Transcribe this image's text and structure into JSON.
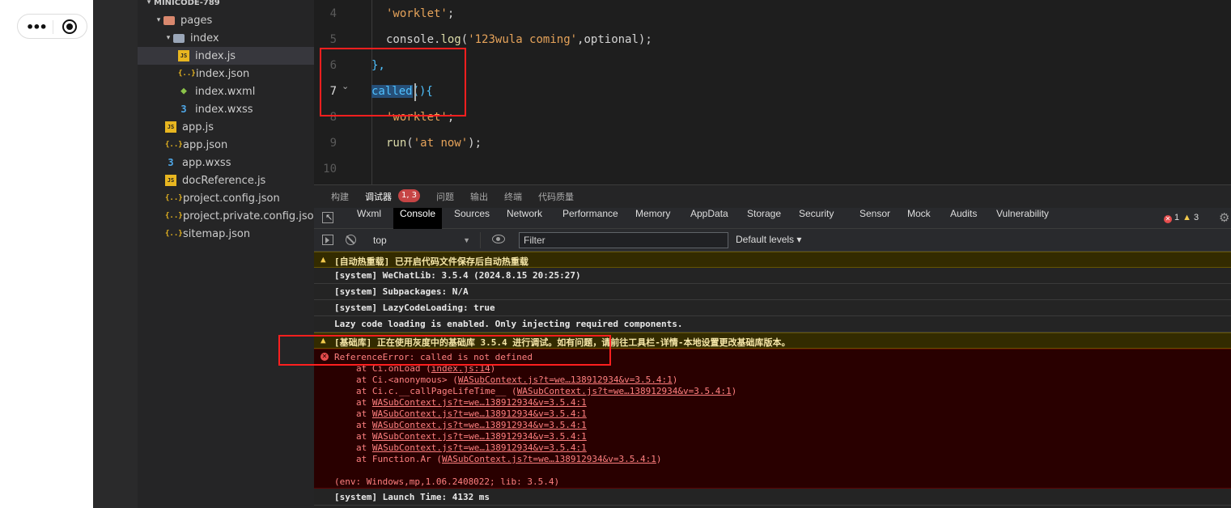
{
  "simulator": {
    "capsule_more": "•••"
  },
  "explorer": {
    "project": "MINICODE-789",
    "items": [
      {
        "label": "pages",
        "type": "folder"
      },
      {
        "label": "index",
        "type": "folder-open"
      },
      {
        "label": "index.js",
        "type": "js"
      },
      {
        "label": "index.json",
        "type": "json"
      },
      {
        "label": "index.wxml",
        "type": "wxml"
      },
      {
        "label": "index.wxss",
        "type": "wxss"
      },
      {
        "label": "app.js",
        "type": "js"
      },
      {
        "label": "app.json",
        "type": "json"
      },
      {
        "label": "app.wxss",
        "type": "wxss"
      },
      {
        "label": "docReference.js",
        "type": "js"
      },
      {
        "label": "project.config.json",
        "type": "json"
      },
      {
        "label": "project.private.config.json",
        "type": "json"
      },
      {
        "label": "sitemap.json",
        "type": "json"
      }
    ],
    "active_item": "index.js",
    "icon_glyphs": {
      "js": "JS",
      "json": "{..}",
      "wxml": "◆",
      "wxss": "З",
      "folder": "",
      "folder-open": ""
    }
  },
  "editor": {
    "line_numbers": [
      "4",
      "5",
      "6",
      "7",
      "8",
      "9",
      "10"
    ],
    "current_line": "7",
    "lines": {
      "l4_str": "'worklet'",
      "l4_p": ";",
      "l5_obj": "console",
      "l5_dot": ".",
      "l5_fn": "log",
      "l5_open": "(",
      "l5_str": "'123wula coming'",
      "l5_rest": ",optional);",
      "l6": "},",
      "l7_sel": "called",
      "l7_rest": "(){",
      "l8_str": "'worklet'",
      "l8_p": ";",
      "l9_fn": "run",
      "l9_open": "(",
      "l9_str": "'at now'",
      "l9_rest": ");"
    }
  },
  "panel_tabs": {
    "items": [
      "构建",
      "调试器",
      "问题",
      "输出",
      "终端",
      "代码质量"
    ],
    "active": "调试器",
    "badge": "1, 3"
  },
  "devtools": {
    "tabs": [
      "Wxml",
      "Console",
      "Sources",
      "Network",
      "Performance",
      "Memory",
      "AppData",
      "Storage",
      "Security",
      "Sensor",
      "Mock",
      "Audits",
      "Vulnerability"
    ],
    "active": "Console",
    "error_count": "1",
    "warning_count": "3",
    "error_glyph": "✕",
    "warning_glyph": "▲",
    "gear_glyph": "⚙"
  },
  "console_toolbar": {
    "context": "top",
    "filter_placeholder": "Filter",
    "levels": "Default levels ▾"
  },
  "console": {
    "messages": [
      {
        "level": "warning",
        "text": "[自动热重载] 已开启代码文件保存后自动热重载"
      },
      {
        "level": "info",
        "text": "[system] WeChatLib: 3.5.4 (2024.8.15 20:25:27)"
      },
      {
        "level": "info",
        "text": "[system] Subpackages: N/A"
      },
      {
        "level": "info",
        "text": "[system] LazyCodeLoading: true"
      },
      {
        "level": "info",
        "text": "Lazy code loading is enabled. Only injecting required components."
      },
      {
        "level": "warning",
        "text": "[基础库] 正在使用灰度中的基础库 3.5.4 进行调试。如有问题，请前往工具栏-详情-本地设置更改基础库版本。"
      }
    ],
    "error": {
      "title": "ReferenceError: called is not defined",
      "stack": [
        {
          "prefix": "at Ci.onLoad (",
          "link": "index.js:14",
          "suffix": ")"
        },
        {
          "prefix": "at Ci.<anonymous> (",
          "link": "WASubContext.js?t=we…138912934&v=3.5.4:1",
          "suffix": ")"
        },
        {
          "prefix": "at Ci.c.__callPageLifeTime__ (",
          "link": "WASubContext.js?t=we…138912934&v=3.5.4:1",
          "suffix": ")"
        },
        {
          "prefix": "at ",
          "link": "WASubContext.js?t=we…138912934&v=3.5.4:1",
          "suffix": ""
        },
        {
          "prefix": "at ",
          "link": "WASubContext.js?t=we…138912934&v=3.5.4:1",
          "suffix": ""
        },
        {
          "prefix": "at ",
          "link": "WASubContext.js?t=we…138912934&v=3.5.4:1",
          "suffix": ""
        },
        {
          "prefix": "at ",
          "link": "WASubContext.js?t=we…138912934&v=3.5.4:1",
          "suffix": ""
        },
        {
          "prefix": "at ",
          "link": "WASubContext.js?t=we…138912934&v=3.5.4:1",
          "suffix": ""
        },
        {
          "prefix": "at Function.Ar (",
          "link": "WASubContext.js?t=we…138912934&v=3.5.4:1",
          "suffix": ")"
        }
      ],
      "env": "(env: Windows,mp,1.06.2408022; lib: 3.5.4)"
    },
    "last": "[system] Launch Time: 4132 ms"
  },
  "colors": {
    "annotation": "#ff1f1f",
    "error_text": "#ff8080",
    "error_bg": "#290000",
    "warning_bg": "#332b00"
  }
}
